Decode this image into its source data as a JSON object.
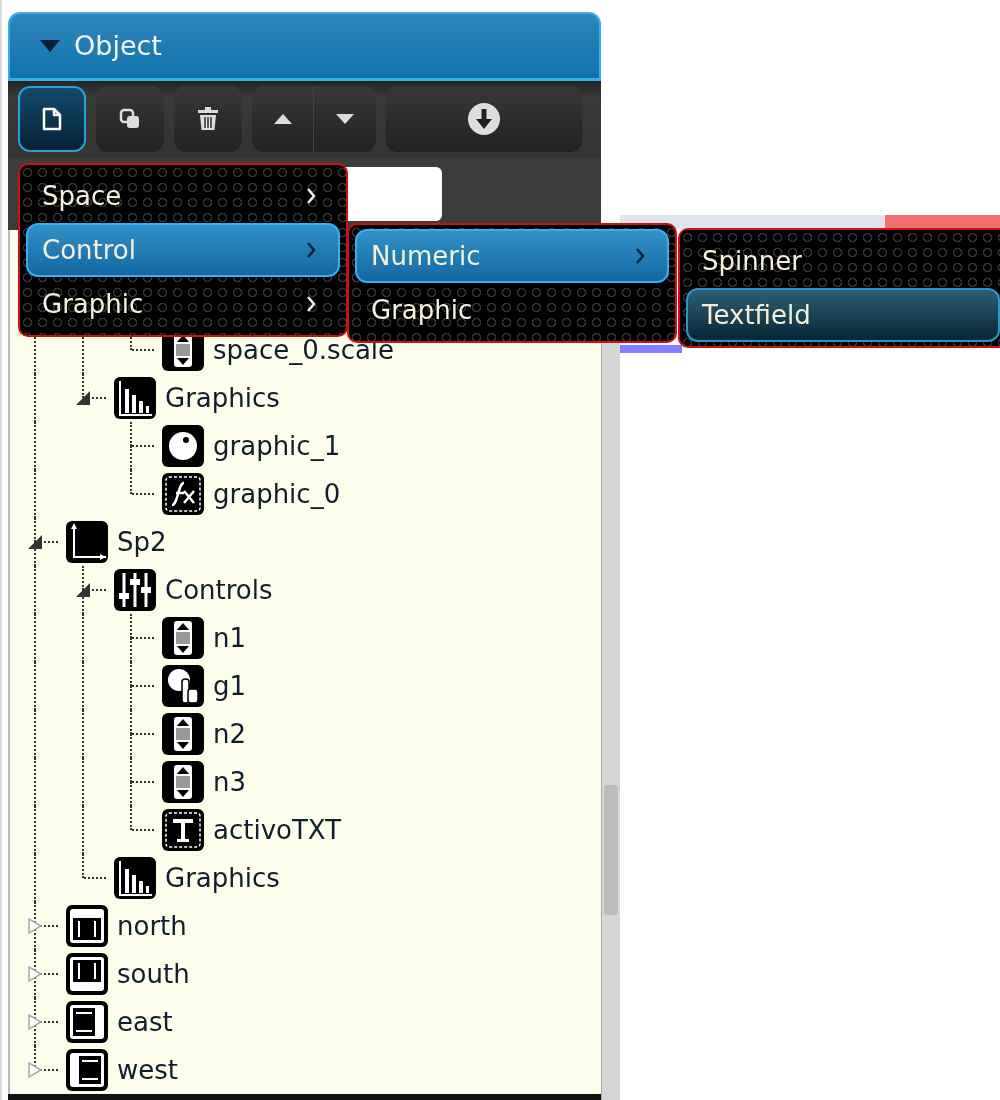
{
  "panel": {
    "title": "Object",
    "expanded": true
  },
  "toolbar": [
    {
      "kind": "new",
      "selected": true
    },
    {
      "kind": "copy",
      "selected": false
    },
    {
      "kind": "delete",
      "selected": false
    },
    {
      "kind": "move-up",
      "selected": false
    },
    {
      "kind": "move-down",
      "selected": false
    },
    {
      "kind": "import",
      "selected": false
    }
  ],
  "tree": [
    {
      "children": [
        {
          "children": [
            {
              "label": "space_0.scale",
              "kind": "spinner"
            }
          ]
        },
        {
          "label": "Graphics",
          "kind": "chart",
          "expanded": true,
          "children": [
            {
              "label": "graphic_1",
              "kind": "point"
            },
            {
              "label": "graphic_0",
              "kind": "function"
            }
          ]
        }
      ]
    },
    {
      "label": "Sp2",
      "kind": "axes",
      "expanded": true,
      "children": [
        {
          "label": "Controls",
          "kind": "sliders",
          "expanded": true,
          "children": [
            {
              "label": "n1",
              "kind": "spinner"
            },
            {
              "label": "g1",
              "kind": "hand"
            },
            {
              "label": "n2",
              "kind": "spinner"
            },
            {
              "label": "n3",
              "kind": "spinner"
            },
            {
              "label": "activoTXT",
              "kind": "text"
            }
          ]
        },
        {
          "label": "Graphics",
          "kind": "chart"
        }
      ]
    },
    {
      "label": "north",
      "kind": "north",
      "expanded": false
    },
    {
      "label": "south",
      "kind": "south",
      "expanded": false
    },
    {
      "label": "east",
      "kind": "east",
      "expanded": false
    },
    {
      "label": "west",
      "kind": "west",
      "expanded": false
    }
  ],
  "menus": [
    {
      "items": [
        {
          "label": "Space",
          "submenu": true,
          "selected": false,
          "hovered": false
        },
        {
          "label": "Control",
          "submenu": true,
          "selected": true,
          "hovered": false
        },
        {
          "label": "Graphic",
          "submenu": true,
          "selected": false,
          "hovered": false
        }
      ]
    },
    {
      "items": [
        {
          "label": "Numeric",
          "submenu": true,
          "selected": true,
          "hovered": false
        },
        {
          "label": "Graphic",
          "submenu": false,
          "selected": false,
          "hovered": false
        }
      ]
    },
    {
      "items": [
        {
          "label": "Spinner",
          "submenu": false,
          "selected": false,
          "hovered": false
        },
        {
          "label": "Textfield",
          "submenu": false,
          "selected": false,
          "hovered": true
        }
      ]
    }
  ]
}
